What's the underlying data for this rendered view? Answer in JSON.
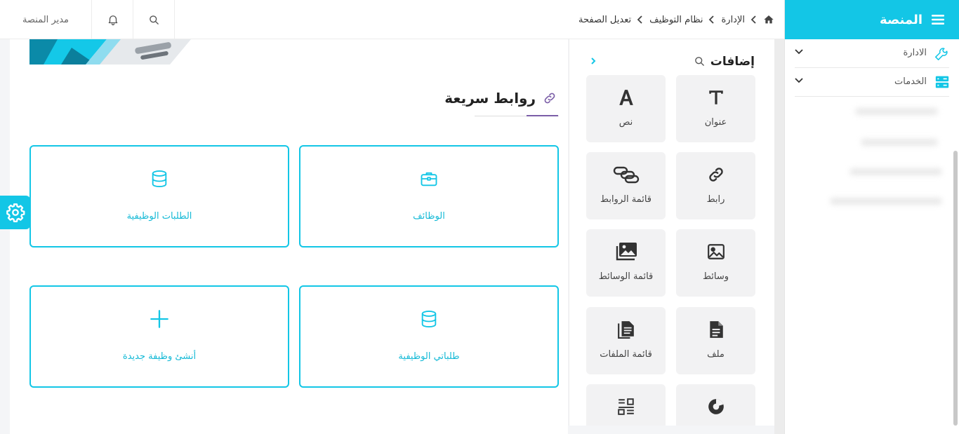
{
  "topbar": {
    "user_name": "مدير المنصة",
    "bell_icon": "bell-icon",
    "search_icon": "search-icon",
    "breadcrumb": {
      "home_icon": "home-icon",
      "items": [
        "الإدارة",
        "نظام التوظيف",
        "تعديل الصفحة"
      ]
    }
  },
  "sidebar": {
    "title": "المنصة",
    "menu_icon": "hamburger-menu-icon",
    "items": [
      {
        "label": "الادارة",
        "icon": "wrench-icon"
      },
      {
        "label": "الخدمات",
        "icon": "server-icon"
      }
    ]
  },
  "additions": {
    "title": "إضافات",
    "tiles": [
      {
        "label": "عنوان",
        "icon": "heading-t-icon"
      },
      {
        "label": "نص",
        "icon": "text-a-icon"
      },
      {
        "label": "رابط",
        "icon": "link-icon"
      },
      {
        "label": "قائمة الروابط",
        "icon": "links-list-icon"
      },
      {
        "label": "وسائط",
        "icon": "image-icon"
      },
      {
        "label": "قائمة الوسائط",
        "icon": "media-list-icon"
      },
      {
        "label": "ملف",
        "icon": "file-icon"
      },
      {
        "label": "قائمة الملفات",
        "icon": "files-list-icon"
      },
      {
        "label": "",
        "icon": "pie-chart-icon"
      },
      {
        "label": "",
        "icon": "list-grid-icon"
      }
    ]
  },
  "quick_links": {
    "title": "روابط سريعة",
    "cards": [
      {
        "label": "الوظائف",
        "icon": "briefcase-icon"
      },
      {
        "label": "الطلبات الوظيفية",
        "icon": "database-icon"
      },
      {
        "label": "طلباتي الوظيفية",
        "icon": "database-icon"
      },
      {
        "label": "أنشئ وظيفة جديدة",
        "icon": "plus-icon"
      }
    ]
  },
  "colors": {
    "accent": "#13c6e6",
    "title_underline": "#7b5ea7"
  }
}
